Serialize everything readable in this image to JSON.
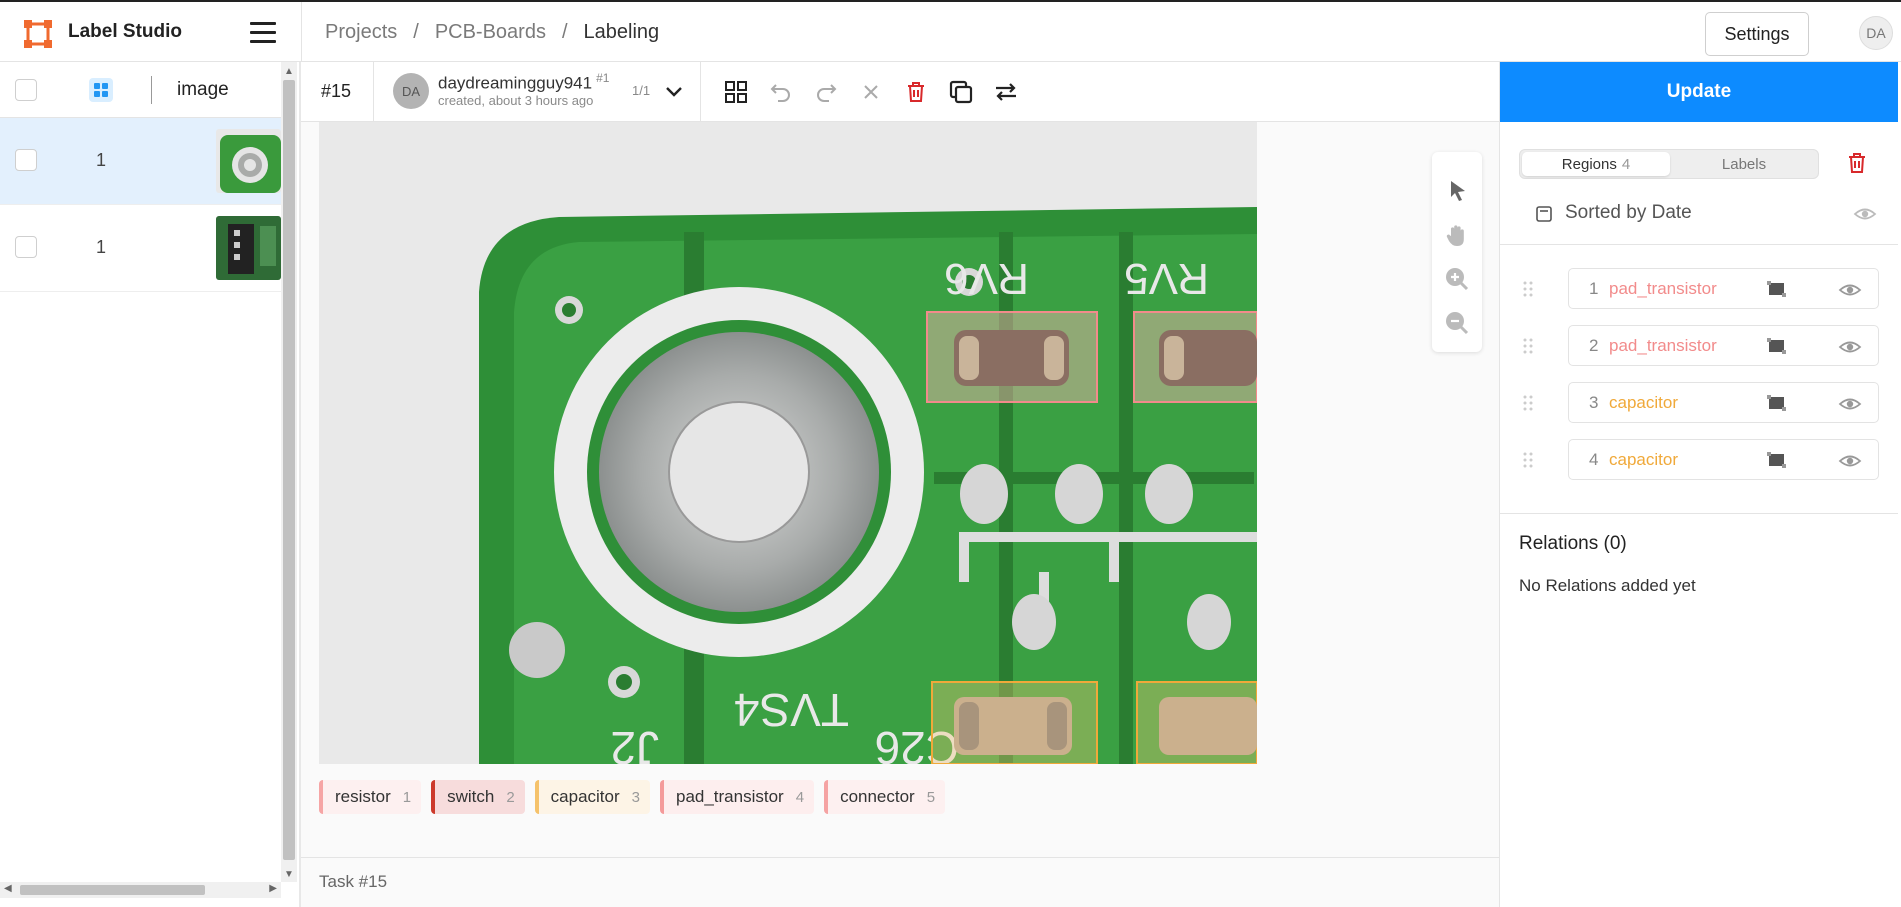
{
  "app": {
    "title": "Label Studio",
    "brand_color": "#f06a2f"
  },
  "breadcrumb": [
    "Projects",
    "PCB-Boards",
    "Labeling"
  ],
  "breadcrumb_sep": "/",
  "header": {
    "settings_label": "Settings",
    "user_initials": "DA"
  },
  "table": {
    "column_label": "image",
    "rows": [
      {
        "value": "1",
        "selected": true
      },
      {
        "value": "1",
        "selected": false
      }
    ]
  },
  "toolbar": {
    "task_id": "#15",
    "annotator": {
      "initials": "DA",
      "name": "daydreamingguy941",
      "badge": "#1",
      "created": "created, about 3 hours ago",
      "count": "1/1"
    }
  },
  "labels": [
    {
      "name": "resistor",
      "hotkey": "1",
      "color": "#f6a5a5",
      "bg": "#fdf0f0"
    },
    {
      "name": "switch",
      "hotkey": "2",
      "color": "#cc3a2c",
      "bg": "#f7dcdc"
    },
    {
      "name": "capacitor",
      "hotkey": "3",
      "color": "#f5c26b",
      "bg": "#fdf4e6"
    },
    {
      "name": "pad_transistor",
      "hotkey": "4",
      "color": "#f49a9a",
      "bg": "#fdeeee"
    },
    {
      "name": "connector",
      "hotkey": "5",
      "color": "#f5a3a3",
      "bg": "#fdf0f0"
    }
  ],
  "footer": {
    "task_label": "Task #15"
  },
  "sidebar": {
    "update_label": "Update",
    "tabs": {
      "regions_label": "Regions",
      "regions_count": "4",
      "labels_label": "Labels"
    },
    "sort_label": "Sorted by Date",
    "regions": [
      {
        "idx": "1",
        "label": "pad_transistor",
        "color": "#f28b8b"
      },
      {
        "idx": "2",
        "label": "pad_transistor",
        "color": "#f28b8b"
      },
      {
        "idx": "3",
        "label": "capacitor",
        "color": "#f0a93a"
      },
      {
        "idx": "4",
        "label": "capacitor",
        "color": "#f0a93a"
      }
    ],
    "relations_title": "Relations (0)",
    "relations_empty": "No Relations added yet"
  },
  "icons": [
    "hamburger-icon",
    "grid-icon",
    "chevron-down-icon",
    "grid-view-icon",
    "undo-icon",
    "redo-icon",
    "close-icon",
    "trash-icon",
    "duplicate-icon",
    "swap-icon",
    "pointer-icon",
    "hand-icon",
    "zoom-in-icon",
    "zoom-out-icon",
    "eye-icon",
    "drag-handle-icon",
    "rectangle-icon",
    "sort-icon"
  ]
}
